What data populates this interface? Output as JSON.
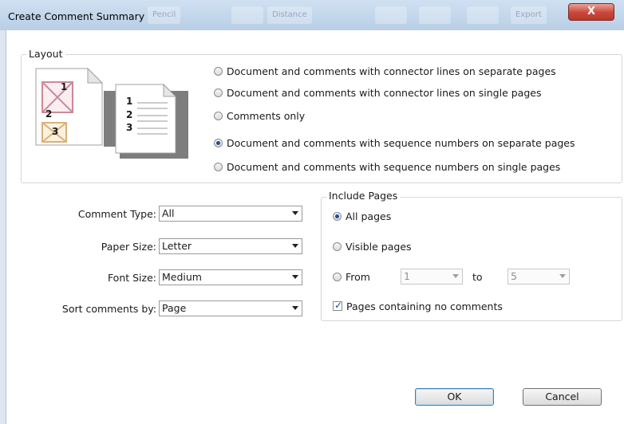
{
  "window": {
    "title": "Create Comment Summary",
    "close_label": "X"
  },
  "background_toolbar": {
    "items": [
      "Pencil",
      "Distance",
      "Export"
    ]
  },
  "layout": {
    "legend": "Layout",
    "options": [
      {
        "label": "Document and comments with connector lines on separate pages",
        "selected": false
      },
      {
        "label": "Document and comments with connector lines on single pages",
        "selected": false
      },
      {
        "label": "Comments only",
        "selected": false
      },
      {
        "label": "Document and comments with sequence numbers on separate pages",
        "selected": true
      },
      {
        "label": "Document and comments with sequence numbers on single pages",
        "selected": false
      }
    ],
    "illustration_numbers": [
      "1",
      "2",
      "3",
      "1",
      "2",
      "3"
    ]
  },
  "settings": {
    "comment_type_label": "Comment Type:",
    "comment_type_value": "All",
    "paper_size_label": "Paper Size:",
    "paper_size_value": "Letter",
    "font_size_label": "Font Size:",
    "font_size_value": "Medium",
    "sort_label": "Sort comments by:",
    "sort_value": "Page"
  },
  "include_pages": {
    "legend": "Include Pages",
    "all_pages": "All pages",
    "visible_pages": "Visible pages",
    "from_label": "From",
    "from_value": "1",
    "to_label": "to",
    "to_value": "5",
    "no_comments_label": "Pages containing no comments",
    "selected": "all_pages",
    "no_comments_checked": true
  },
  "buttons": {
    "ok": "OK",
    "cancel": "Cancel"
  },
  "colors": {
    "title_bar": "#c4d7ec",
    "close_red": "#c9463a",
    "radio_dot": "#1d4e9e",
    "illustration_gray": "#7d7d7d",
    "comment_pink": "#c98a9a",
    "comment_tan": "#d7b27a"
  }
}
